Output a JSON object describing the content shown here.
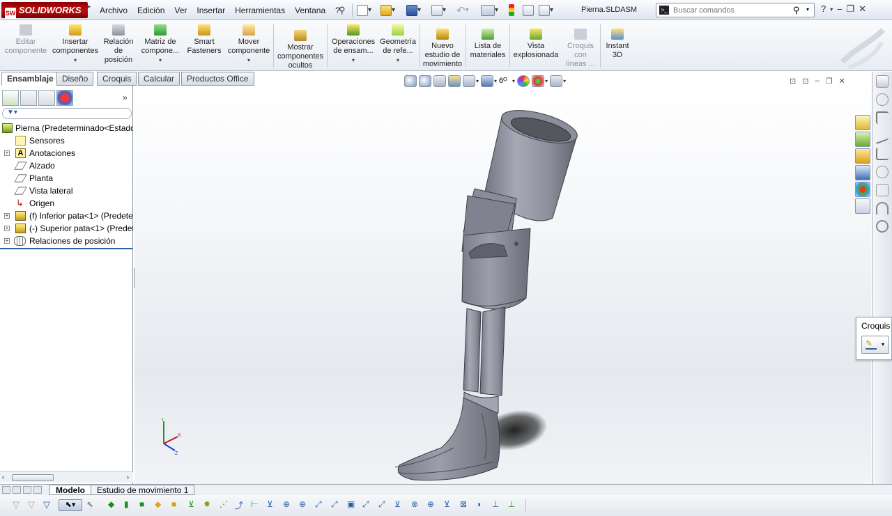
{
  "app": {
    "brand": "SOLIDWORKS",
    "brand_mark": "SW",
    "document_title": "Pierna.SLDASM"
  },
  "menus": [
    "Archivo",
    "Edición",
    "Ver",
    "Insertar",
    "Herramientas",
    "Ventana",
    "?"
  ],
  "search": {
    "placeholder": "Buscar comandos"
  },
  "ribbon": {
    "buttons": [
      {
        "label": "Editar componente",
        "enabled": false
      },
      {
        "label": "Insertar componentes",
        "enabled": true,
        "dropdown": true
      },
      {
        "label": "Relación de posición",
        "enabled": true
      },
      {
        "label": "Matriz de compone...",
        "enabled": true,
        "dropdown": true
      },
      {
        "label": "Smart Fasteners",
        "enabled": true
      },
      {
        "label": "Mover componente",
        "enabled": true,
        "dropdown": true
      },
      {
        "label": "Mostrar componentes ocultos",
        "enabled": true
      },
      {
        "label": "Operaciones de ensam...",
        "enabled": true,
        "dropdown": true
      },
      {
        "label": "Geometría de refe...",
        "enabled": true,
        "dropdown": true
      },
      {
        "label": "Nuevo estudio de movimiento",
        "enabled": true
      },
      {
        "label": "Lista de materiales",
        "enabled": true
      },
      {
        "label": "Vista explosionada",
        "enabled": true
      },
      {
        "label": "Croquis con líneas ...",
        "enabled": false
      },
      {
        "label": "Instant 3D",
        "enabled": true
      }
    ]
  },
  "command_tabs": [
    "Ensamblaje",
    "Diseño",
    "Croquis",
    "Calcular",
    "Productos Office"
  ],
  "feature_tree": {
    "items": [
      {
        "label": "Pierna  (Predeterminado<Estado",
        "icon": "assembly-icon"
      },
      {
        "label": "Sensores",
        "icon": "sensors-icon"
      },
      {
        "label": "Anotaciones",
        "icon": "annotations-icon",
        "expandable": true
      },
      {
        "label": "Alzado",
        "icon": "plane-icon"
      },
      {
        "label": "Planta",
        "icon": "plane-icon"
      },
      {
        "label": "Vista lateral",
        "icon": "plane-icon"
      },
      {
        "label": "Origen",
        "icon": "origin-icon"
      },
      {
        "label": "(f) Inferior pata<1> (Predete",
        "icon": "part-icon",
        "expandable": true
      },
      {
        "label": "(-) Superior pata<1> (Predet",
        "icon": "part-icon",
        "expandable": true
      },
      {
        "label": "Relaciones de posición",
        "icon": "mates-icon",
        "expandable": true
      }
    ]
  },
  "croquis_popup": {
    "title": "Croquis"
  },
  "bottom_tabs": [
    "Modelo",
    "Estudio de movimiento 1"
  ],
  "colors": {
    "brand_red": "#c10f0f",
    "part_gray": "#8b8e9a",
    "accent_blue": "#2a5fa8"
  }
}
